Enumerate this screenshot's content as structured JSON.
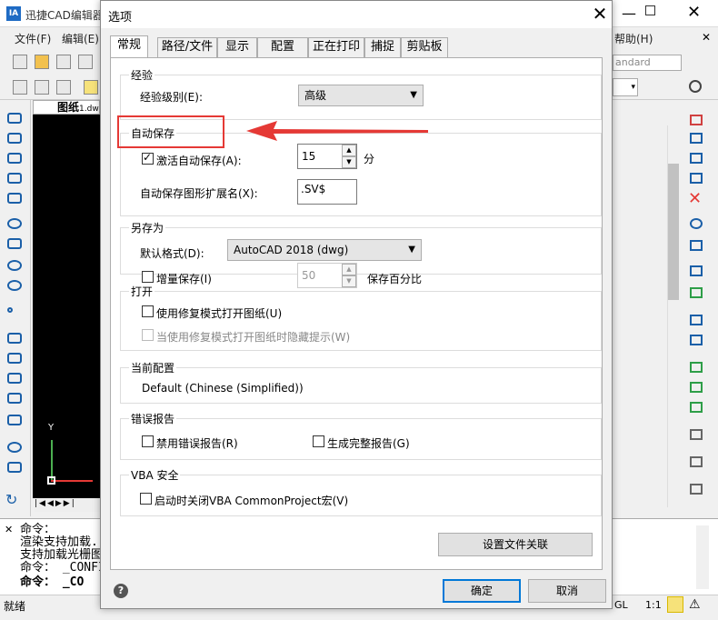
{
  "bg_app": {
    "title": "迅捷CAD编辑器",
    "menu": [
      "文件(F)",
      "编辑(E)"
    ],
    "right_menu": "帮助(H)",
    "style_box": "andard",
    "doc_tab": "图纸",
    "doc_tab_suffix": "1.dw",
    "cmd_lines": [
      "命令：",
      "渲染支持加载...",
      "支持加载光栅图...",
      "命令：  _CONFIG",
      "命令：  _CO"
    ],
    "status": "就绪",
    "status_right": "GL",
    "scale": "1:1",
    "axis_y": "Y"
  },
  "dialog": {
    "title": "选项",
    "tabs": [
      "常规",
      "路径/文件",
      "显示",
      "配置",
      "正在打印",
      "捕捉",
      "剪贴板"
    ],
    "experience": {
      "group": "经验",
      "level_label": "经验级别(E):",
      "level_value": "高级"
    },
    "autosave": {
      "group": "自动保存",
      "enable_label": "激活自动保存(A):",
      "minutes_value": "15",
      "minutes_unit": "分",
      "ext_label": "自动保存图形扩展名(X):",
      "ext_value": ".SV$"
    },
    "saveas": {
      "group": "另存为",
      "format_label": "默认格式(D):",
      "format_value": "AutoCAD 2018 (dwg)",
      "incremental_label": "增量保存(I)",
      "percent_value": "50",
      "percent_label": "保存百分比"
    },
    "open": {
      "group": "打开",
      "repair_label": "使用修复模式打开图纸(U)",
      "hide_label": "当使用修复模式打开图纸时隐藏提示(W)"
    },
    "profile": {
      "group": "当前配置",
      "value": "Default (Chinese (Simplified))"
    },
    "errors": {
      "group": "错误报告",
      "disable_label": "禁用错误报告(R)",
      "full_label": "生成完整报告(G)"
    },
    "vba": {
      "group": "VBA 安全",
      "close_label": "启动时关闭VBA CommonProject宏(V)"
    },
    "assoc_button": "设置文件关联",
    "ok_button": "确定",
    "cancel_button": "取消",
    "help": "?"
  },
  "colors": {
    "accent": "#0078d7",
    "highlight": "#e53935",
    "tool": "#1a5fa8"
  }
}
